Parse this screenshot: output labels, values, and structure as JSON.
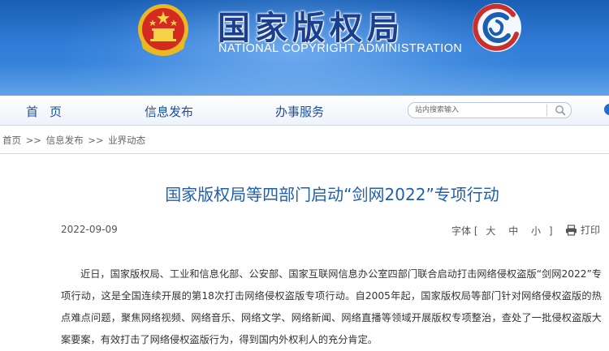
{
  "header": {
    "title": "国家版权局",
    "subtitle": "NATIONAL COPYRIGHT ADMINISTRATION",
    "emblem_icon": "national-emblem",
    "logo_icon": "copyright-logo-mark"
  },
  "nav": {
    "items": [
      {
        "label": "首页"
      },
      {
        "label": "信息发布"
      },
      {
        "label": "办事服务"
      }
    ],
    "search": {
      "placeholder": "站内搜索输入",
      "icon": "search-icon"
    }
  },
  "breadcrumb": {
    "items": [
      "首页",
      "信息发布",
      "业界动态"
    ],
    "separator": ">>"
  },
  "article": {
    "title": "国家版权局等四部门启动“剑网2022”专项行动",
    "date": "2022-09-09",
    "font_size": {
      "label": "字体",
      "open_bracket": "[",
      "close_bracket": "]",
      "options": [
        "大",
        "中",
        "小"
      ]
    },
    "print_label": "打印",
    "print_icon": "printer-icon",
    "body": "近日，国家版权局、工业和信息化部、公安部、国家互联网信息办公室四部门联合启动打击网络侵权盗版“剑网2022”专项行动，这是全国连续开展的第18次打击网络侵权盗版专项行动。自2005年起，国家版权局等部门针对网络侵权盗版的热点难点问题，聚焦网络视频、网络音乐、网络文学、网络新闻、网络直播等领域开展版权专项整治，查处了一批侵权盗版大案要案，有效打击了网络侵权盗版行为，得到国内外权利人的充分肯定。"
  },
  "colors": {
    "banner": "#2f7bd6",
    "title": "#1f5fb0",
    "nav_text": "#1c4fa0",
    "body_text": "#333333"
  }
}
